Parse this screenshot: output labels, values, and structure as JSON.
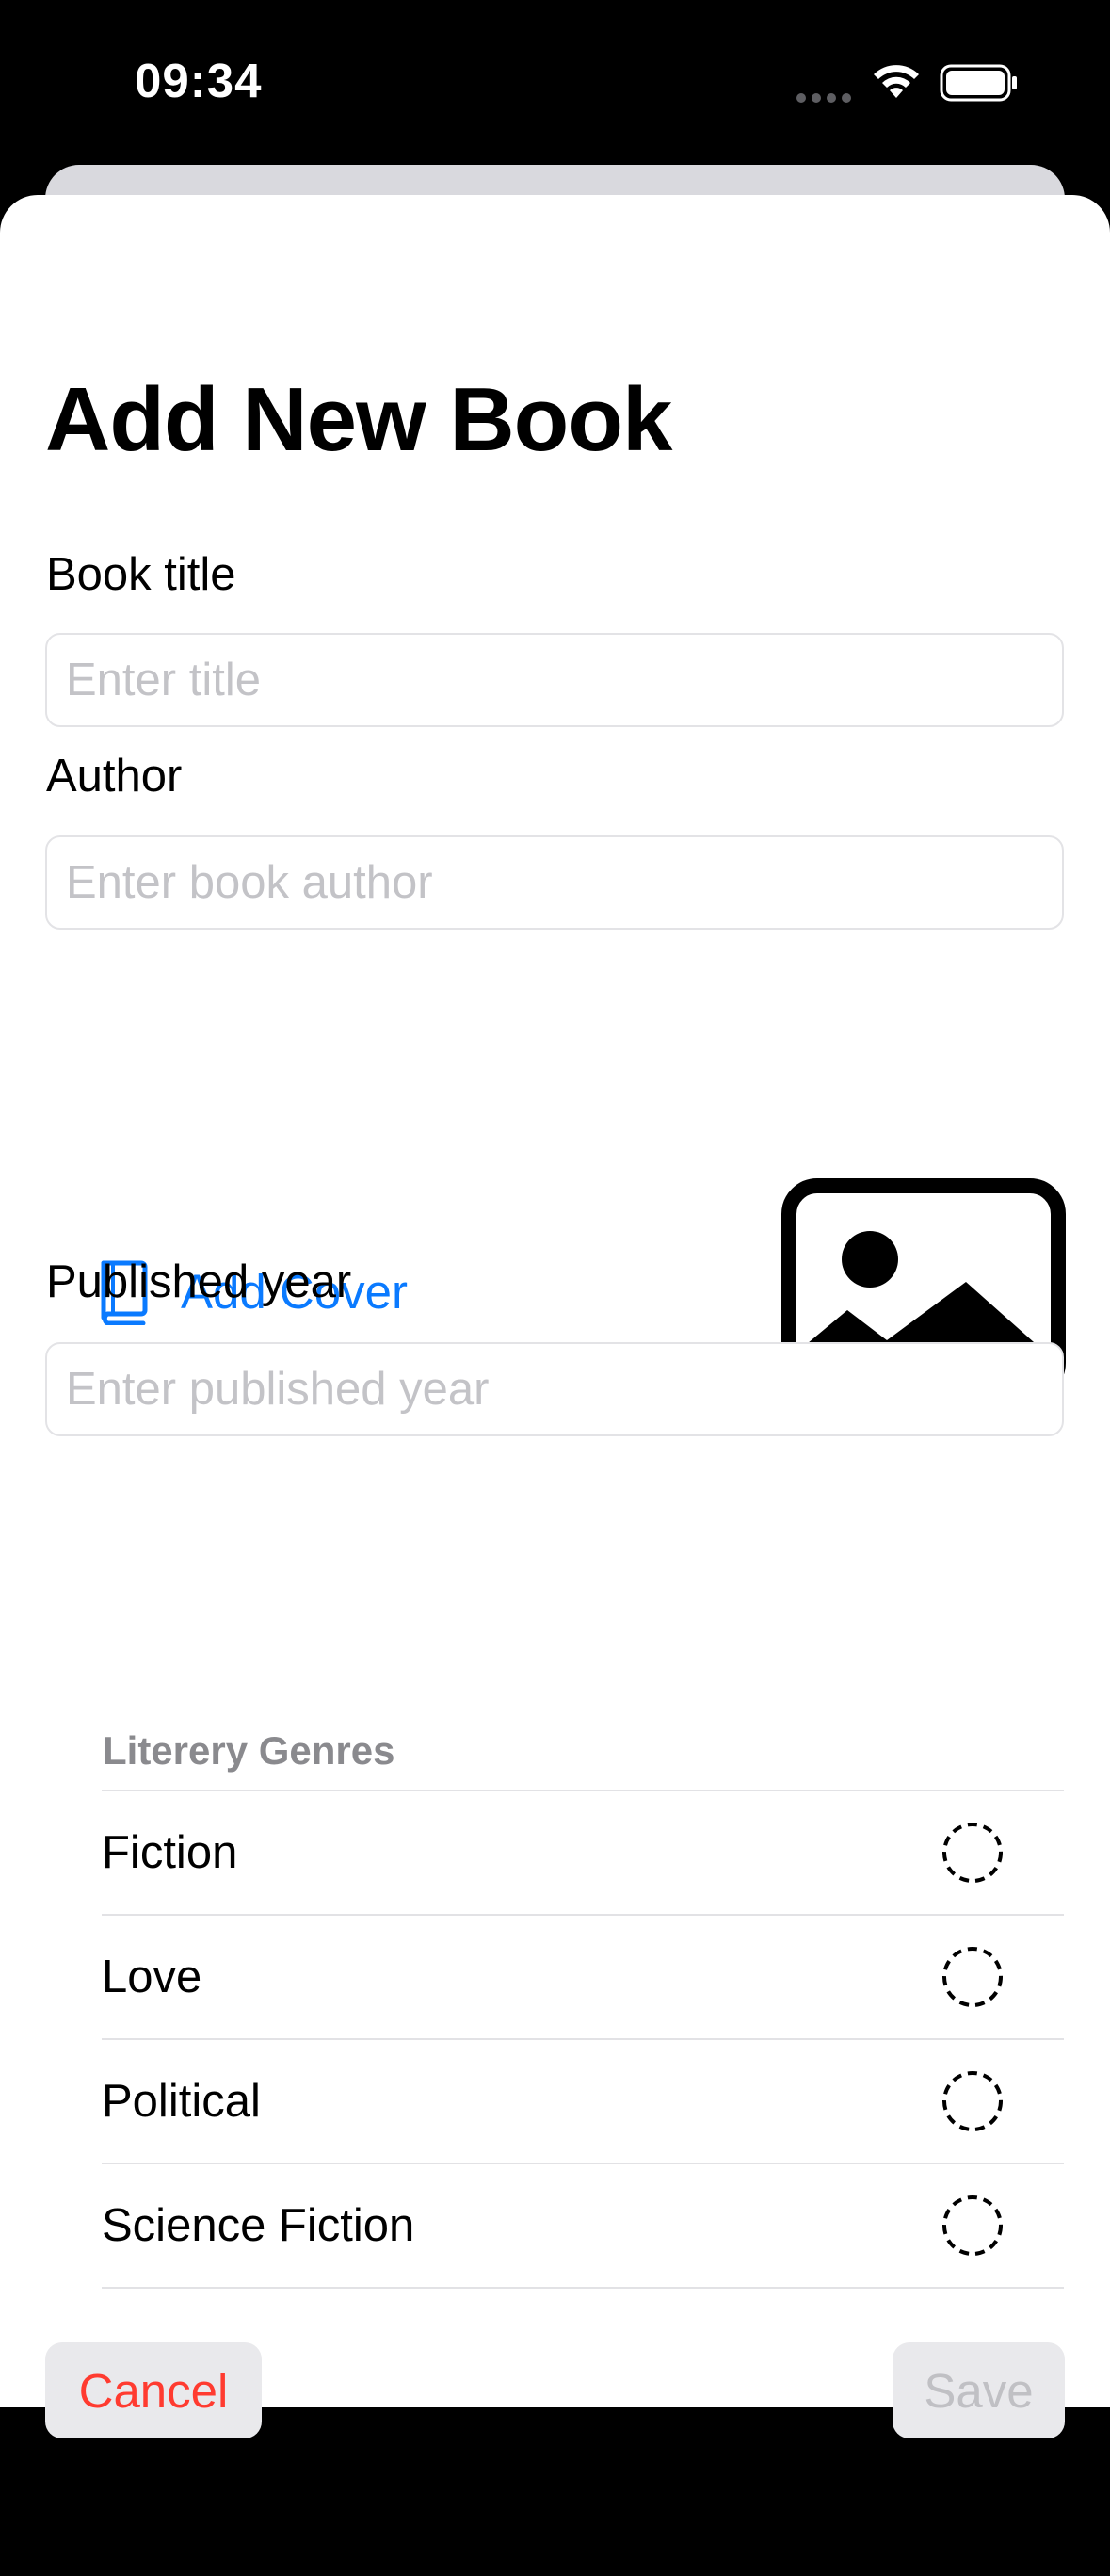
{
  "status_bar": {
    "time": "09:34"
  },
  "form": {
    "title": "Add New Book",
    "book_title": {
      "label": "Book title",
      "placeholder": "Enter title",
      "value": ""
    },
    "author": {
      "label": "Author",
      "placeholder": "Enter book author",
      "value": ""
    },
    "cover": {
      "button_label": "Add Cover",
      "button_icon": "book-icon",
      "preview_icon": "photo-placeholder-icon"
    },
    "published_year": {
      "label": "Published year",
      "placeholder": "Enter published year",
      "value": ""
    },
    "genres": {
      "header": "Literery Genres",
      "items": [
        {
          "label": "Fiction",
          "selected": false
        },
        {
          "label": "Love",
          "selected": false
        },
        {
          "label": "Political",
          "selected": false
        },
        {
          "label": "Science Fiction",
          "selected": false
        }
      ]
    }
  },
  "actions": {
    "cancel_label": "Cancel",
    "save_label": "Save",
    "save_enabled": false
  },
  "colors": {
    "accent": "#0A7AFF",
    "destructive": "#FF3B30",
    "disabled_text": "#C0C0C4",
    "placeholder": "#C3C3C7",
    "section_header": "#8A8A8E"
  }
}
